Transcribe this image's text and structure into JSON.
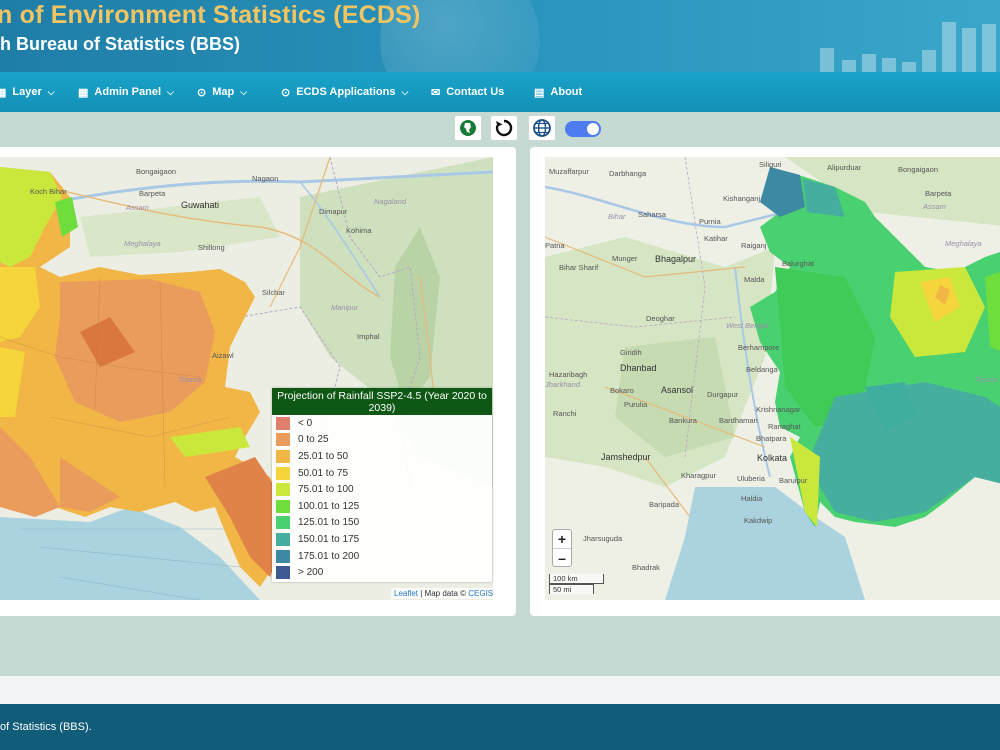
{
  "header": {
    "title": "n of Environment Statistics (ECDS)",
    "subtitle": "h Bureau of Statistics (BBS)"
  },
  "nav": {
    "items": [
      {
        "label": "Layer",
        "icon": "grid-icon",
        "has_dropdown": true
      },
      {
        "label": "Admin Panel",
        "icon": "grid-icon",
        "has_dropdown": true
      },
      {
        "label": "Map",
        "icon": "map-pin-icon",
        "has_dropdown": true
      },
      {
        "label": "ECDS Applications",
        "icon": "map-pin-icon",
        "has_dropdown": true
      },
      {
        "label": "Contact Us",
        "icon": "envelope-icon",
        "has_dropdown": false
      },
      {
        "label": "About",
        "icon": "book-icon",
        "has_dropdown": false
      }
    ]
  },
  "toolbar": {
    "buttons": [
      "bangladesh-map-icon",
      "reset-icon",
      "globe-icon"
    ],
    "toggle_on": true
  },
  "left_map": {
    "labels": [
      "Bongaigaon",
      "Koch Bihar",
      "Barpeta",
      "Assam",
      "Guwahati",
      "Nagaon",
      "Meghalaya",
      "Dimapur",
      "Nagaland",
      "Kohima",
      "Shillong",
      "Silchar",
      "Manipur",
      "Imphal",
      "Aizawl",
      "Tripura"
    ],
    "legend": {
      "title": "Projection of Rainfall SSP2-4.5 (Year 2020 to 2039)",
      "items": [
        {
          "label": "< 0",
          "color": "#e07f6c"
        },
        {
          "label": "0 to 25",
          "color": "#e99c5b"
        },
        {
          "label": "25.01 to 50",
          "color": "#f1b646"
        },
        {
          "label": "50.01 to 75",
          "color": "#f5d43c"
        },
        {
          "label": "75.01 to 100",
          "color": "#c9e83b"
        },
        {
          "label": "100.01 to 125",
          "color": "#6fdd3c"
        },
        {
          "label": "125.01 to 150",
          "color": "#49d071"
        },
        {
          "label": "150.01 to 175",
          "color": "#46ae9e"
        },
        {
          "label": "175.01 to 200",
          "color": "#3d88a2"
        },
        {
          "label": "> 200",
          "color": "#3d5a92"
        }
      ]
    },
    "attribution": {
      "leaflet": "Leaflet",
      "text": " | Map data © ",
      "link": "CEGIS"
    }
  },
  "right_map": {
    "labels": [
      "Siliguri",
      "Muzaffarpur",
      "Darbhanga",
      "Kishanganj",
      "Alipurduar",
      "Bongaigaon",
      "Barpeta",
      "Assam",
      "Bihar",
      "Saharsa",
      "Purnia",
      "Katihar",
      "Raiganj",
      "Balurghat",
      "Meghalaya",
      "Patna",
      "Munger",
      "Bhagalpur",
      "Bihar Sharif",
      "Malda",
      "Deoghar",
      "West Bengal",
      "Berhampore",
      "Giridih",
      "Dhanbad",
      "Beldanga",
      "Hazaribagh",
      "Bokaro",
      "Asansol",
      "Durgapur",
      "Jharkhand",
      "Ranchi",
      "Purulia",
      "Bankura",
      "Bardhaman",
      "Krishnanagar",
      "Ranaghat",
      "Bhatpara",
      "Jamshedpur",
      "Kolkata",
      "Kharagpur",
      "Uluberia",
      "Baruipur",
      "Haldia",
      "Baripada",
      "Kakdwip",
      "Jharsuguda",
      "Bhadrak",
      "Tripura"
    ],
    "zoom_in": "+",
    "zoom_out": "–",
    "scale_km": "100 km",
    "scale_mi": "50 mi"
  },
  "footer": {
    "text": "of Statistics (BBS)."
  }
}
